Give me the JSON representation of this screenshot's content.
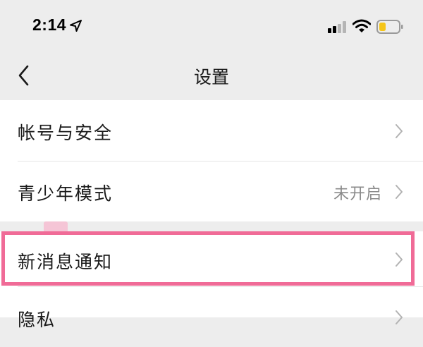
{
  "status_bar": {
    "time": "2:14",
    "icons": [
      "location-arrow-icon",
      "cellular-signal-icon",
      "wifi-icon",
      "battery-low-icon"
    ],
    "battery_color": "#f5c518"
  },
  "nav": {
    "back_icon": "chevron-left-icon",
    "title": "设置"
  },
  "settings": {
    "items": [
      {
        "label": "帐号与安全",
        "value": ""
      },
      {
        "label": "青少年模式",
        "value": "未开启"
      },
      {
        "label": "新消息通知",
        "value": "",
        "highlighted": true
      },
      {
        "label": "隐私",
        "value": ""
      }
    ]
  },
  "colors": {
    "background": "#ededed",
    "highlight": "#f06b97",
    "value_text": "#8a8a8a"
  }
}
